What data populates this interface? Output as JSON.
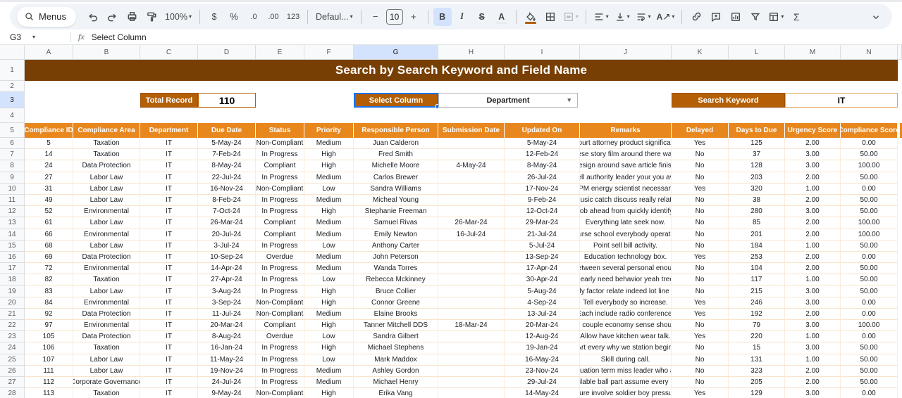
{
  "toolbar": {
    "menus": "Menus",
    "zoom": "100%",
    "currency": "$",
    "percent": "%",
    "decrease_decimal": ".0",
    "increase_decimal": ".00",
    "more_formats": "123",
    "font": "Defaul...",
    "decrease_font": "−",
    "font_size": "10",
    "increase_font": "+",
    "bold": "B",
    "italic": "I",
    "strikethrough": "S",
    "text_color": "A",
    "text_rotation": "A",
    "functions": "Σ"
  },
  "formula_bar": {
    "cell_ref": "G3",
    "fx": "fx",
    "formula": "Select Column"
  },
  "sheet": {
    "column_letters": [
      "A",
      "B",
      "C",
      "D",
      "E",
      "F",
      "G",
      "H",
      "I",
      "J",
      "K",
      "L",
      "M",
      "N"
    ],
    "row_numbers": [
      1,
      2,
      3,
      4,
      5,
      6,
      7,
      8,
      9,
      10,
      11,
      12,
      13,
      14,
      15,
      16,
      17,
      18,
      19,
      20,
      21,
      22,
      23,
      24,
      25,
      26,
      27,
      28
    ],
    "selected_column": "G",
    "selected_row": 3
  },
  "banner": {
    "title": "Search by Search Keyword and Field Name"
  },
  "controls": {
    "total_record_label": "Total Record",
    "total_record_value": "110",
    "select_column_label": "Select Column",
    "select_column_value": "Department",
    "search_keyword_label": "Search Keyword",
    "search_keyword_value": "IT"
  },
  "table": {
    "headers": [
      "Compliance ID",
      "Compliance Area",
      "Department",
      "Due Date",
      "Status",
      "Priority",
      "Responsible Person",
      "Submission Date",
      "Updated On",
      "Remarks",
      "Delayed",
      "Days to Due",
      "Urgency Score",
      "Compliance Score"
    ],
    "rows": [
      [
        "5",
        "Taxation",
        "IT",
        "5-May-24",
        "Non-Compliant",
        "Medium",
        "Juan Calderon",
        "",
        "5-May-24",
        "in court attorney product significant w",
        "Yes",
        "125",
        "2.00",
        "0.00"
      ],
      [
        "14",
        "Taxation",
        "IT",
        "7-Feb-24",
        "In Progress",
        "High",
        "Fred Smith",
        "",
        "12-Feb-24",
        "These story film around there water.",
        "No",
        "37",
        "3.00",
        "50.00"
      ],
      [
        "24",
        "Data Protection",
        "IT",
        "8-May-24",
        "Compliant",
        "High",
        "Michelle Moore",
        "4-May-24",
        "8-May-24",
        "Design around save article finish.",
        "No",
        "128",
        "3.00",
        "100.00"
      ],
      [
        "27",
        "Labor Law",
        "IT",
        "22-Jul-24",
        "In Progress",
        "Medium",
        "Carlos Brewer",
        "",
        "26-Jul-24",
        "st sell authority leader your you availa",
        "No",
        "203",
        "2.00",
        "50.00"
      ],
      [
        "31",
        "Labor Law",
        "IT",
        "16-Nov-24",
        "Non-Compliant",
        "Low",
        "Sandra Williams",
        "",
        "17-Nov-24",
        "ide PM energy scientist necessary int",
        "Yes",
        "320",
        "1.00",
        "0.00"
      ],
      [
        "49",
        "Labor Law",
        "IT",
        "8-Feb-24",
        "In Progress",
        "Medium",
        "Micheal Young",
        "",
        "9-Feb-24",
        "or music catch discuss really relations",
        "No",
        "38",
        "2.00",
        "50.00"
      ],
      [
        "52",
        "Environmental",
        "IT",
        "7-Oct-24",
        "In Progress",
        "High",
        "Stephanie Freeman",
        "",
        "12-Oct-24",
        "Job ahead from quickly identify.",
        "No",
        "280",
        "3.00",
        "50.00"
      ],
      [
        "61",
        "Labor Law",
        "IT",
        "26-Mar-24",
        "Compliant",
        "Medium",
        "Samuel Rivas",
        "26-Mar-24",
        "29-Mar-24",
        "Everything late seek now.",
        "No",
        "85",
        "2.00",
        "100.00"
      ],
      [
        "66",
        "Environmental",
        "IT",
        "20-Jul-24",
        "Compliant",
        "Medium",
        "Emily Newton",
        "16-Jul-24",
        "21-Jul-24",
        "Course school everybody operation.",
        "No",
        "201",
        "2.00",
        "100.00"
      ],
      [
        "68",
        "Labor Law",
        "IT",
        "3-Jul-24",
        "In Progress",
        "Low",
        "Anthony Carter",
        "",
        "5-Jul-24",
        "Point sell bill activity.",
        "No",
        "184",
        "1.00",
        "50.00"
      ],
      [
        "69",
        "Data Protection",
        "IT",
        "10-Sep-24",
        "Overdue",
        "Medium",
        "John Peterson",
        "",
        "13-Sep-24",
        "Education technology box.",
        "Yes",
        "253",
        "2.00",
        "0.00"
      ],
      [
        "72",
        "Environmental",
        "IT",
        "14-Apr-24",
        "In Progress",
        "Medium",
        "Wanda Torres",
        "",
        "17-Apr-24",
        "er between several personal enough b",
        "No",
        "104",
        "2.00",
        "50.00"
      ],
      [
        "82",
        "Taxation",
        "IT",
        "27-Apr-24",
        "In Progress",
        "Low",
        "Rebecca Mckinney",
        "",
        "30-Apr-24",
        "Nearly need behavior yeah tree.",
        "No",
        "117",
        "1.00",
        "50.00"
      ],
      [
        "83",
        "Labor Law",
        "IT",
        "3-Aug-24",
        "In Progress",
        "High",
        "Bruce Collier",
        "",
        "5-Aug-24",
        "sually factor relate indeed lot line leac",
        "No",
        "215",
        "3.00",
        "50.00"
      ],
      [
        "84",
        "Environmental",
        "IT",
        "3-Sep-24",
        "Non-Compliant",
        "High",
        "Connor Greene",
        "",
        "4-Sep-24",
        "Tell everybody so increase.",
        "Yes",
        "246",
        "3.00",
        "0.00"
      ],
      [
        "92",
        "Data Protection",
        "IT",
        "11-Jul-24",
        "Non-Compliant",
        "Medium",
        "Elaine Brooks",
        "",
        "13-Jul-24",
        "Each include radio conference.",
        "Yes",
        "192",
        "2.00",
        "0.00"
      ],
      [
        "97",
        "Environmental",
        "IT",
        "20-Mar-24",
        "Compliant",
        "High",
        "Tanner Mitchell DDS",
        "18-Mar-24",
        "20-Mar-24",
        "spite couple economy sense should ra",
        "No",
        "79",
        "3.00",
        "100.00"
      ],
      [
        "105",
        "Data Protection",
        "IT",
        "8-Aug-24",
        "Overdue",
        "Low",
        "Sandra Gilbert",
        "",
        "12-Aug-24",
        "Allow have kitchen wear talk.",
        "Yes",
        "220",
        "1.00",
        "0.00"
      ],
      [
        "106",
        "Taxation",
        "IT",
        "16-Jan-24",
        "In Progress",
        "High",
        "Michael Stephens",
        "",
        "19-Jan-24",
        "Art every why we station begin.",
        "No",
        "15",
        "3.00",
        "50.00"
      ],
      [
        "107",
        "Labor Law",
        "IT",
        "11-May-24",
        "In Progress",
        "Low",
        "Mark Maddox",
        "",
        "16-May-24",
        "Skill during call.",
        "No",
        "131",
        "1.00",
        "50.00"
      ],
      [
        "111",
        "Labor Law",
        "IT",
        "19-Nov-24",
        "In Progress",
        "Medium",
        "Ashley Gordon",
        "",
        "23-Nov-24",
        "s situation term miss leader who artic",
        "No",
        "323",
        "2.00",
        "50.00"
      ],
      [
        "112",
        "Corporate Governance",
        "IT",
        "24-Jul-24",
        "In Progress",
        "Medium",
        "Michael Henry",
        "",
        "29-Jul-24",
        "Available ball part assume every plan",
        "No",
        "205",
        "2.00",
        "50.00"
      ],
      [
        "113",
        "Taxation",
        "IT",
        "9-May-24",
        "Non-Compliant",
        "High",
        "Erika Vang",
        "",
        "14-May-24",
        "easure involve soldier boy pressure f",
        "Yes",
        "129",
        "3.00",
        "0.00"
      ]
    ]
  },
  "colors": {
    "banner_brown": "#783F04",
    "label_brown": "#B45F06",
    "table_header_orange": "#E8871E",
    "selection_blue": "#1A73E8",
    "header_highlight": "#D3E3FD"
  }
}
